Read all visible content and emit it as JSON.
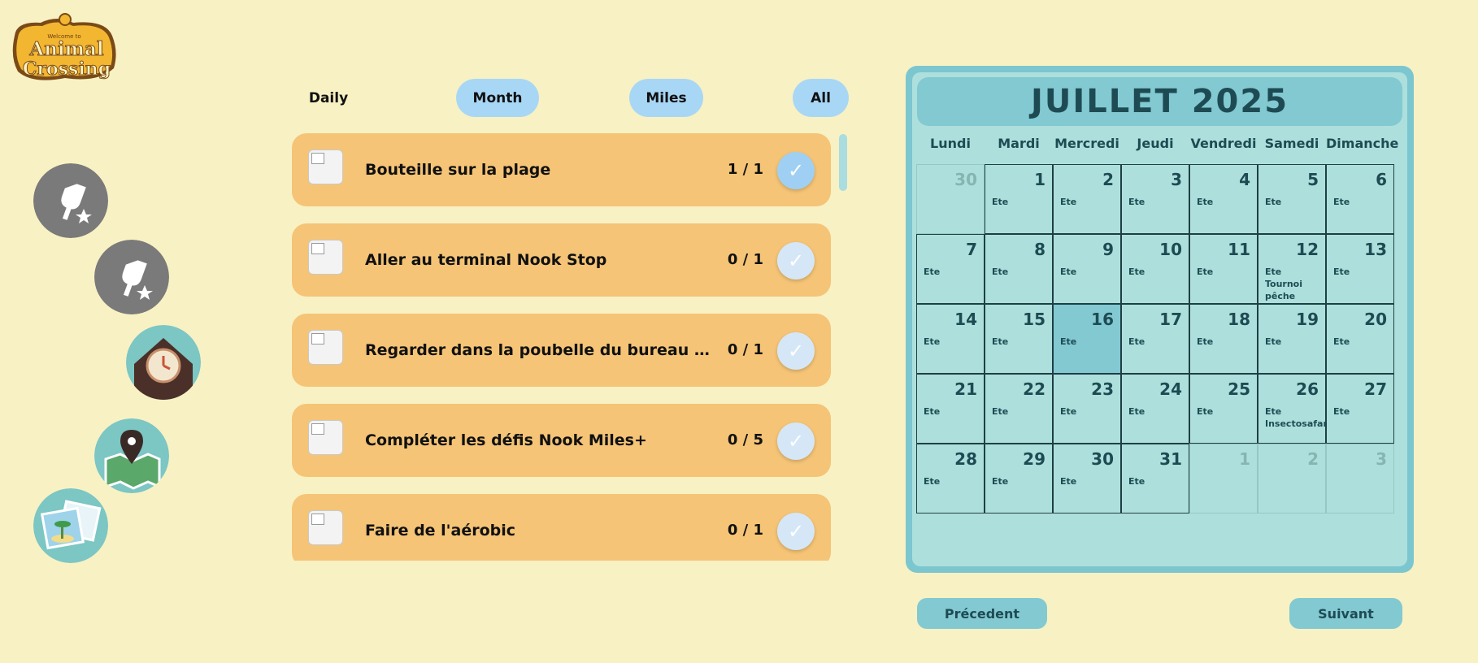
{
  "logo": {
    "line1": "Animal",
    "line2": "Crossing",
    "tag": "Welcome to",
    "icon": "animal-crossing-logo"
  },
  "side_icons": [
    {
      "name": "shovel-star-icon"
    },
    {
      "name": "shovel-star-icon"
    },
    {
      "name": "clock-house-icon"
    },
    {
      "name": "map-pin-icon"
    },
    {
      "name": "photos-icon"
    }
  ],
  "tabs": {
    "daily": "Daily",
    "month": "Month",
    "miles": "Miles",
    "all": "All"
  },
  "tasks": [
    {
      "title": "Bouteille sur la plage",
      "count": "1 / 1",
      "done": true
    },
    {
      "title": "Aller au terminal Nook Stop",
      "count": "0 / 1",
      "done": false
    },
    {
      "title": "Regarder dans la poubelle du bureau des résidents",
      "count": "0 / 1",
      "done": false
    },
    {
      "title": "Compléter les défis Nook Miles+",
      "count": "0 / 5",
      "done": false
    },
    {
      "title": "Faire de l'aérobic",
      "count": "0 / 1",
      "done": false
    }
  ],
  "check_glyph": "✓",
  "calendar": {
    "title": "JUILLET 2025",
    "days_of_week": [
      "Lundi",
      "Mardi",
      "Mercredi",
      "Jeudi",
      "Vendredi",
      "Samedi",
      "Dimanche"
    ],
    "cells": [
      {
        "d": "30",
        "other": true,
        "ev": ""
      },
      {
        "d": "1",
        "ev": "Ete"
      },
      {
        "d": "2",
        "ev": "Ete"
      },
      {
        "d": "3",
        "ev": "Ete"
      },
      {
        "d": "4",
        "ev": "Ete"
      },
      {
        "d": "5",
        "ev": "Ete"
      },
      {
        "d": "6",
        "ev": "Ete"
      },
      {
        "d": "7",
        "ev": "Ete"
      },
      {
        "d": "8",
        "ev": "Ete"
      },
      {
        "d": "9",
        "ev": "Ete"
      },
      {
        "d": "10",
        "ev": "Ete"
      },
      {
        "d": "11",
        "ev": "Ete"
      },
      {
        "d": "12",
        "ev": "Ete\nTournoi pêche"
      },
      {
        "d": "13",
        "ev": "Ete"
      },
      {
        "d": "14",
        "ev": "Ete"
      },
      {
        "d": "15",
        "ev": "Ete"
      },
      {
        "d": "16",
        "ev": "Ete",
        "today": true
      },
      {
        "d": "17",
        "ev": "Ete"
      },
      {
        "d": "18",
        "ev": "Ete"
      },
      {
        "d": "19",
        "ev": "Ete"
      },
      {
        "d": "20",
        "ev": "Ete"
      },
      {
        "d": "21",
        "ev": "Ete"
      },
      {
        "d": "22",
        "ev": "Ete"
      },
      {
        "d": "23",
        "ev": "Ete"
      },
      {
        "d": "24",
        "ev": "Ete"
      },
      {
        "d": "25",
        "ev": "Ete"
      },
      {
        "d": "26",
        "ev": "Ete\nInsectosafari"
      },
      {
        "d": "27",
        "ev": "Ete"
      },
      {
        "d": "28",
        "ev": "Ete"
      },
      {
        "d": "29",
        "ev": "Ete"
      },
      {
        "d": "30",
        "ev": "Ete"
      },
      {
        "d": "31",
        "ev": "Ete"
      },
      {
        "d": "1",
        "other": true,
        "ev": ""
      },
      {
        "d": "2",
        "other": true,
        "ev": ""
      },
      {
        "d": "3",
        "other": true,
        "ev": ""
      }
    ],
    "prev_label": "Précedent",
    "next_label": "Suivant"
  }
}
